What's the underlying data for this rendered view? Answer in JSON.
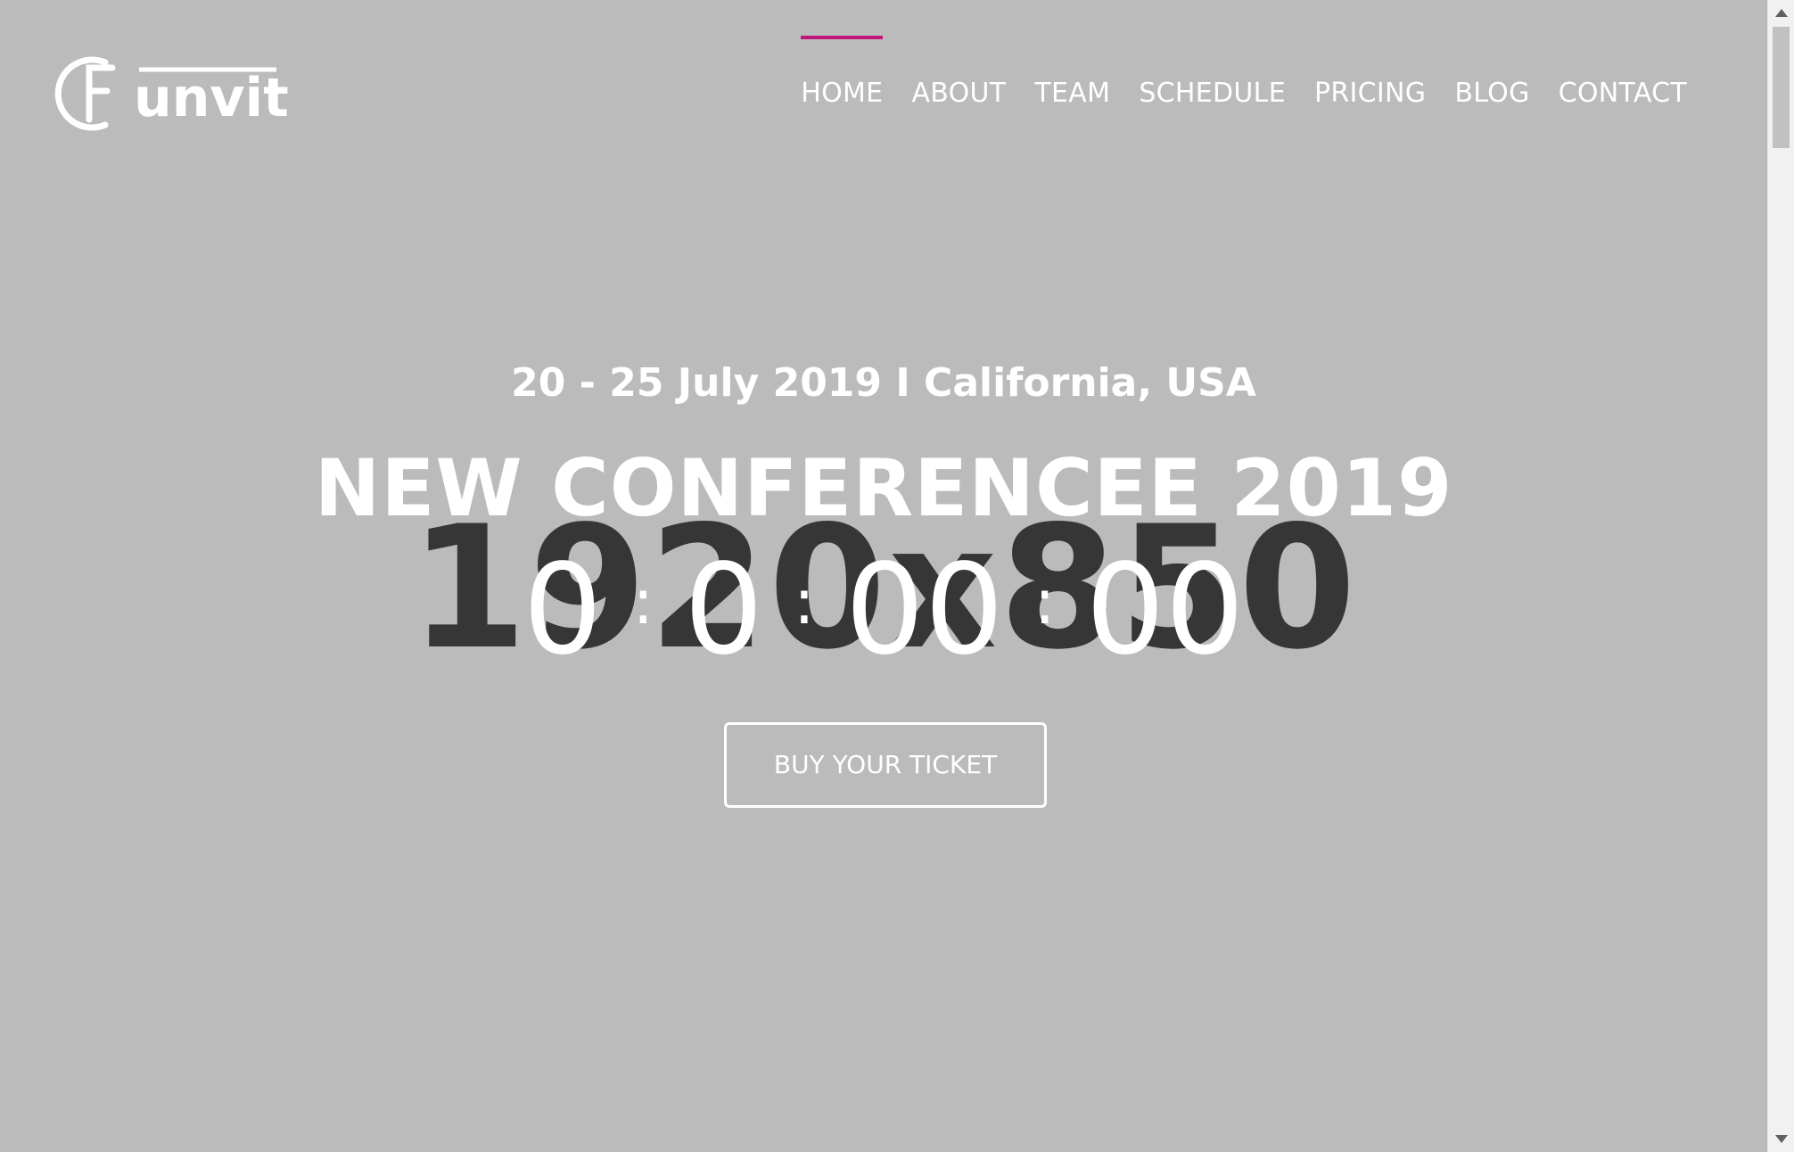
{
  "brand": {
    "logo_text": "Funvit",
    "accent_color": "#c0157a"
  },
  "nav": {
    "items": [
      {
        "label": "HOME",
        "active": true
      },
      {
        "label": "ABOUT",
        "active": false
      },
      {
        "label": "TEAM",
        "active": false
      },
      {
        "label": "SCHEDULE",
        "active": false
      },
      {
        "label": "PRICING",
        "active": false
      },
      {
        "label": "BLOG",
        "active": false
      },
      {
        "label": "CONTACT",
        "active": false
      }
    ]
  },
  "hero": {
    "placeholder_text": "1920x850",
    "date_location": "20 - 25 July 2019 I California, USA",
    "title": "NEW CONFERENCEE 2019",
    "countdown": {
      "days": "0",
      "hours": "0",
      "minutes": "00",
      "seconds": "00",
      "separator": ":"
    },
    "cta_label": "BUY YOUR TICKET"
  },
  "scrollbar": {
    "icons": [
      "scroll-up-icon",
      "scroll-down-icon"
    ]
  }
}
